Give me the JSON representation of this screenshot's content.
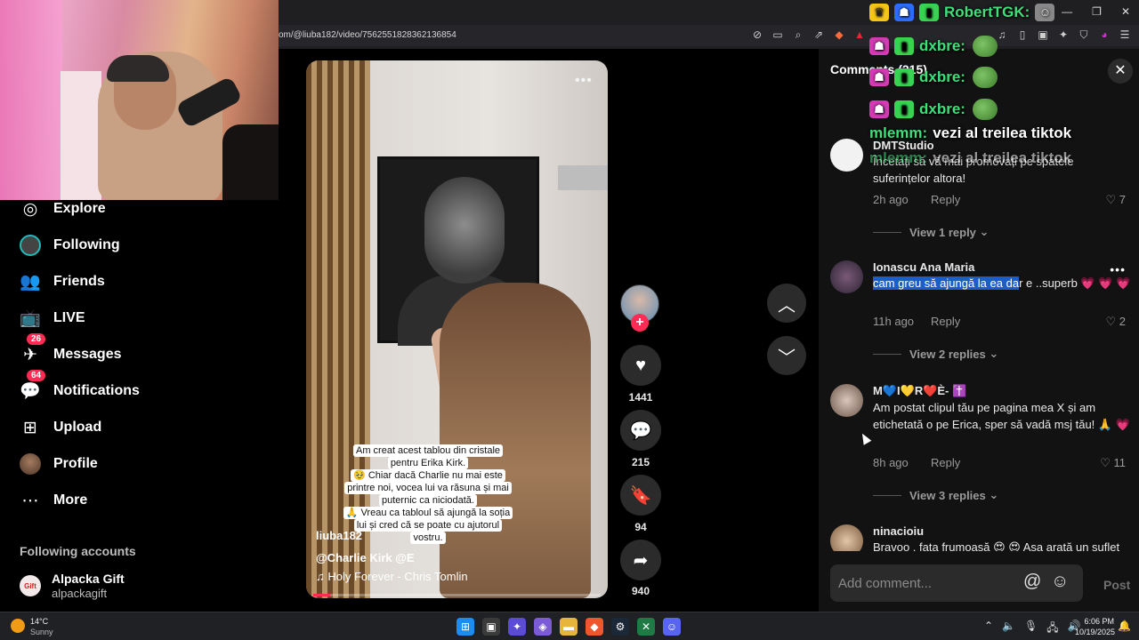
{
  "browser": {
    "url": "om/@liuba182/video/7562551828362136854"
  },
  "sidebar": {
    "items": [
      {
        "label": "Explore",
        "icon": "compass-icon"
      },
      {
        "label": "Following",
        "icon": "following-avatar-icon"
      },
      {
        "label": "Friends",
        "icon": "friends-icon"
      },
      {
        "label": "LIVE",
        "icon": "live-icon"
      },
      {
        "label": "Messages",
        "icon": "messages-icon",
        "badge": "26"
      },
      {
        "label": "Notifications",
        "icon": "notifications-icon",
        "badge": "64"
      },
      {
        "label": "Upload",
        "icon": "upload-icon"
      },
      {
        "label": "Profile",
        "icon": "profile-avatar-icon"
      },
      {
        "label": "More",
        "icon": "more-icon"
      }
    ],
    "following_title": "Following accounts",
    "following_accounts": [
      {
        "name": "Alpacka Gift",
        "handle": "alpackagift"
      }
    ]
  },
  "video": {
    "caption_lines": [
      "Am creat acest tablou din cristale",
      "pentru Erika Kirk.",
      "🥹 Chiar dacă Charlie nu mai este",
      "printre noi, vocea lui va răsuna și mai",
      "puternic ca niciodată.",
      "🙏 Vreau ca tabloul să ajungă la soția",
      "lui și cred că se poate cu ajutorul",
      "vostru."
    ],
    "author": "liuba182",
    "description": "@Charlie Kirk  @E",
    "sound": "♫  Holy Forever - Chris Tomlin",
    "progress": 0.06
  },
  "actions": {
    "likes": "1441",
    "comments": "215",
    "saves": "94",
    "shares": "940"
  },
  "comments_panel": {
    "title": "Comments (215)",
    "comments": [
      {
        "user": "DMTStudio",
        "text": "Încetați să vă mai promovați pe spatele suferințelor altora!",
        "time": "2h ago",
        "reply": "Reply",
        "likes": "7",
        "view_replies": "View 1 reply"
      },
      {
        "user": "Ionascu Ana Maria",
        "text_highlight": "cam greu să ajungă la ea da",
        "text_rest": "r e ..superb 💗 💗 💗",
        "time": "11h ago",
        "reply": "Reply",
        "likes": "2",
        "view_replies": "View 2 replies"
      },
      {
        "user": "M💙I💛R❤️È- ✝️",
        "text": "Am postat clipul tău pe pagina mea X și am etichetată o pe Erica, sper să vadă msj tău! 🙏 💗",
        "time": "8h ago",
        "reply": "Reply",
        "likes": "11",
        "view_replies": "View 3 replies"
      },
      {
        "user": "ninacioiu",
        "text": "Bravoo , fata frumoasă 😍 😍 Asa arată un suflet"
      }
    ],
    "input_placeholder": "Add comment...",
    "post_label": "Post"
  },
  "stream_overlay": {
    "lines": [
      {
        "name": "RobertTGK:",
        "text": "",
        "color": "#3ee07a"
      },
      {
        "name": "dxbre:",
        "text": "",
        "color": "#3ee07a"
      },
      {
        "name": "dxbre:",
        "text": "",
        "color": "#3ee07a"
      },
      {
        "name": "dxbre:",
        "text": "",
        "color": "#3ee07a"
      },
      {
        "name": "mlemm:",
        "text": "vezi al treilea tiktok",
        "color": "#3ee07a"
      },
      {
        "name": "mlemm:",
        "text": "vezi al treilea tiktok",
        "color": "#3ee07a"
      }
    ]
  },
  "taskbar": {
    "temperature": "14°C",
    "condition": "Sunny",
    "time": "6:06 PM",
    "date": "10/19/2025"
  },
  "colors": {
    "accent": "#fe2c55",
    "panel_bg": "#121212",
    "highlight": "#1c5ec9"
  }
}
